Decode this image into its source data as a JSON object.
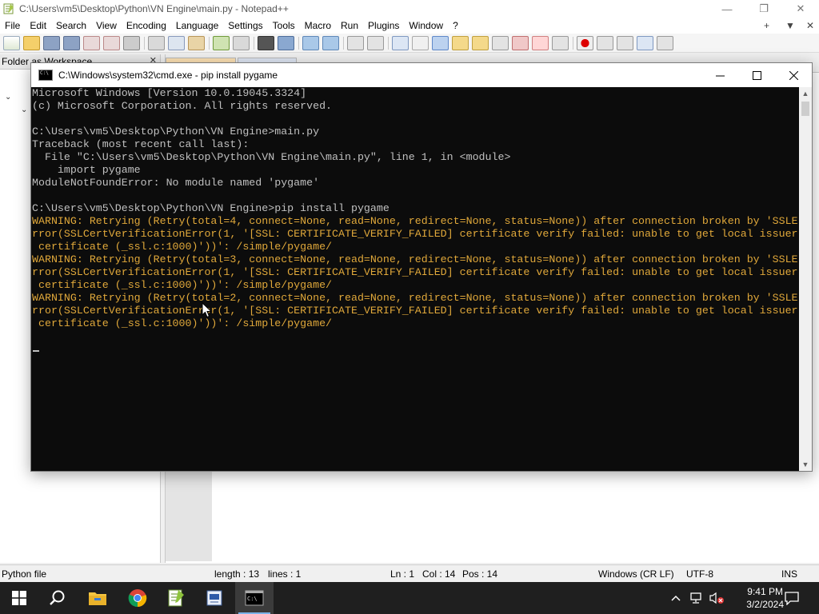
{
  "npp": {
    "title": "C:\\Users\\vm5\\Desktop\\Python\\VN Engine\\main.py - Notepad++",
    "menu": [
      "File",
      "Edit",
      "Search",
      "View",
      "Encoding",
      "Language",
      "Settings",
      "Tools",
      "Macro",
      "Run",
      "Plugins",
      "Window",
      "?"
    ],
    "menu_right": [
      "+",
      "▼",
      "✕"
    ],
    "panel_title": "Folder as Workspace",
    "status": {
      "file_type": "Python file",
      "length": "length : 13",
      "lines": "lines : 1",
      "ln": "Ln : 1",
      "col": "Col : 14",
      "pos": "Pos : 14",
      "eol": "Windows (CR LF)",
      "encoding": "UTF-8",
      "mode": "INS"
    }
  },
  "cmd": {
    "title": "C:\\Windows\\system32\\cmd.exe - pip  install pygame",
    "lines": [
      {
        "text": "Microsoft Windows [Version 10.0.19045.3324]",
        "kind": "normal"
      },
      {
        "text": "(c) Microsoft Corporation. All rights reserved.",
        "kind": "normal"
      },
      {
        "text": "",
        "kind": "normal"
      },
      {
        "text": "C:\\Users\\vm5\\Desktop\\Python\\VN Engine>main.py",
        "kind": "normal"
      },
      {
        "text": "Traceback (most recent call last):",
        "kind": "normal"
      },
      {
        "text": "  File \"C:\\Users\\vm5\\Desktop\\Python\\VN Engine\\main.py\", line 1, in <module>",
        "kind": "normal"
      },
      {
        "text": "    import pygame",
        "kind": "normal"
      },
      {
        "text": "ModuleNotFoundError: No module named 'pygame'",
        "kind": "normal"
      },
      {
        "text": "",
        "kind": "normal"
      },
      {
        "text": "C:\\Users\\vm5\\Desktop\\Python\\VN Engine>pip install pygame",
        "kind": "normal"
      },
      {
        "text": "WARNING: Retrying (Retry(total=4, connect=None, read=None, redirect=None, status=None)) after connection broken by 'SSLE",
        "kind": "warn"
      },
      {
        "text": "rror(SSLCertVerificationError(1, '[SSL: CERTIFICATE_VERIFY_FAILED] certificate verify failed: unable to get local issuer",
        "kind": "warn"
      },
      {
        "text": " certificate (_ssl.c:1000)'))': /simple/pygame/",
        "kind": "warn"
      },
      {
        "text": "WARNING: Retrying (Retry(total=3, connect=None, read=None, redirect=None, status=None)) after connection broken by 'SSLE",
        "kind": "warn"
      },
      {
        "text": "rror(SSLCertVerificationError(1, '[SSL: CERTIFICATE_VERIFY_FAILED] certificate verify failed: unable to get local issuer",
        "kind": "warn"
      },
      {
        "text": " certificate (_ssl.c:1000)'))': /simple/pygame/",
        "kind": "warn"
      },
      {
        "text": "WARNING: Retrying (Retry(total=2, connect=None, read=None, redirect=None, status=None)) after connection broken by 'SSLE",
        "kind": "warn"
      },
      {
        "text": "rror(SSLCertVerificationError(1, '[SSL: CERTIFICATE_VERIFY_FAILED] certificate verify failed: unable to get local issuer",
        "kind": "warn"
      },
      {
        "text": " certificate (_ssl.c:1000)'))': /simple/pygame/",
        "kind": "warn"
      }
    ]
  },
  "taskbar": {
    "time": "9:41 PM",
    "date": "3/2/2024"
  },
  "colors": {
    "console_bg": "#0c0c0c",
    "console_text": "#c0c0c0",
    "warning_text": "#e0a83a",
    "taskbar_bg": "#1f1f1f",
    "accent": "#7ab3e8"
  }
}
